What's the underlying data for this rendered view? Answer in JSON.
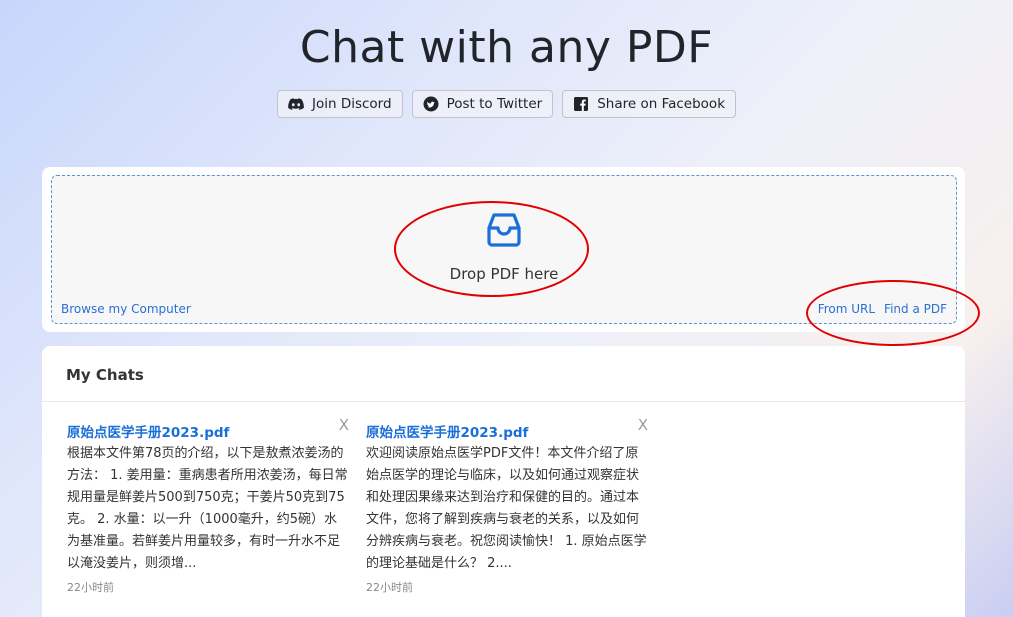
{
  "header": {
    "title": "Chat with any PDF"
  },
  "share": [
    {
      "label": "Join Discord",
      "icon": "discord-icon"
    },
    {
      "label": "Post to Twitter",
      "icon": "twitter-icon"
    },
    {
      "label": "Share on Facebook",
      "icon": "facebook-icon"
    }
  ],
  "upload": {
    "drop_text": "Drop PDF here",
    "browse_label": "Browse my Computer",
    "from_url_label": "From URL",
    "find_pdf_label": "Find a PDF",
    "icon": "inbox-icon"
  },
  "chats": {
    "heading": "My Chats",
    "items": [
      {
        "title": "原始点医学手册2023.pdf",
        "description": "根据本文件第78页的介绍，以下是敖煮浓姜汤的方法： 1. 姜用量：重病患者所用浓姜汤，每日常规用量是鲜姜片500到750克；干姜片50克到75克。 2. 水量：以一升（1000毫升，约5碗）水为基准量。若鲜姜片用量较多，有时一升水不足以淹没姜片，则须增...",
        "time": "22小时前",
        "close": "X"
      },
      {
        "title": "原始点医学手册2023.pdf",
        "description": "欢迎阅读原始点医学PDF文件！本文件介绍了原始点医学的理论与临床，以及如何通过观察症状和处理因果缘来达到治疗和保健的目的。通过本文件，您将了解到疾病与衰老的关系，以及如何分辨疾病与衰老。祝您阅读愉快！ 1. 原始点医学的理论基础是什么？ 2....",
        "time": "22小时前",
        "close": "X"
      }
    ]
  },
  "colors": {
    "accent": "#1a6fd8",
    "annotation_circle": "#e00000"
  }
}
